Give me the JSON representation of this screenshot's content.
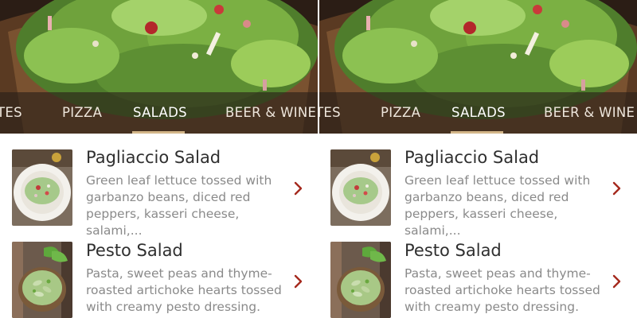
{
  "categories": {
    "tabs": [
      {
        "label": "TES"
      },
      {
        "label": "PIZZA"
      },
      {
        "label": "SALADS"
      },
      {
        "label": "BEER & WINE"
      }
    ],
    "active_tab": "SALADS"
  },
  "menu_items": [
    {
      "name": "Pagliaccio Salad",
      "description_lines": [
        "Green leaf lettuce tossed with",
        "garbanzo beans, diced red",
        "peppers, kasseri cheese, salami,..."
      ],
      "image": "pagliaccio-salad-plate"
    },
    {
      "name": "Pesto Salad",
      "description_lines": [
        "Pasta, sweet peas and thyme-",
        "roasted artichoke hearts tossed",
        "with creamy pesto dressing."
      ],
      "image": "pesto-pasta-bowl"
    }
  ],
  "icons": {
    "chevron": "chevron-right-icon"
  },
  "colors": {
    "accent_underline": "#d3b689",
    "chevron": "#a52a1e",
    "title_text": "#2f2f2f",
    "description_text": "#8a8a8a",
    "tab_bar_overlay": "rgba(40,30,24,0.62)"
  }
}
